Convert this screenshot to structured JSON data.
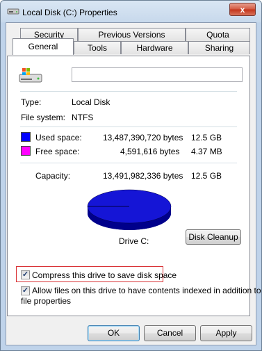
{
  "window": {
    "title": "Local Disk (C:) Properties",
    "close_glyph": "x"
  },
  "tabs": {
    "row1": [
      "Security",
      "Previous Versions",
      "Quota"
    ],
    "row2": [
      "General",
      "Tools",
      "Hardware",
      "Sharing"
    ],
    "active": "General"
  },
  "general": {
    "name_value": "",
    "type_label": "Type:",
    "type_value": "Local Disk",
    "fs_label": "File system:",
    "fs_value": "NTFS",
    "used_label": "Used space:",
    "used_bytes": "13,487,390,720 bytes",
    "used_size": "12.5 GB",
    "free_label": "Free space:",
    "free_bytes": "4,591,616 bytes",
    "free_size": "4.37 MB",
    "capacity_label": "Capacity:",
    "capacity_bytes": "13,491,982,336 bytes",
    "capacity_size": "12.5 GB",
    "drive_label": "Drive C:",
    "disk_cleanup": "Disk Cleanup",
    "compress_label": "Compress this drive to save disk space",
    "compress_checked": true,
    "index_label_line1": "Allow files on this drive to have contents indexed in addition to",
    "index_label_line2": "file properties",
    "index_checked": true
  },
  "colors": {
    "used": "#0000ff",
    "free": "#ff00ff",
    "pie_top": "#1515d6",
    "pie_side": "#00008b"
  },
  "chart_data": {
    "type": "pie",
    "categories": [
      "Used space",
      "Free space"
    ],
    "values": [
      13487390720,
      4591616
    ]
  },
  "buttons": {
    "ok": "OK",
    "cancel": "Cancel",
    "apply": "Apply"
  }
}
